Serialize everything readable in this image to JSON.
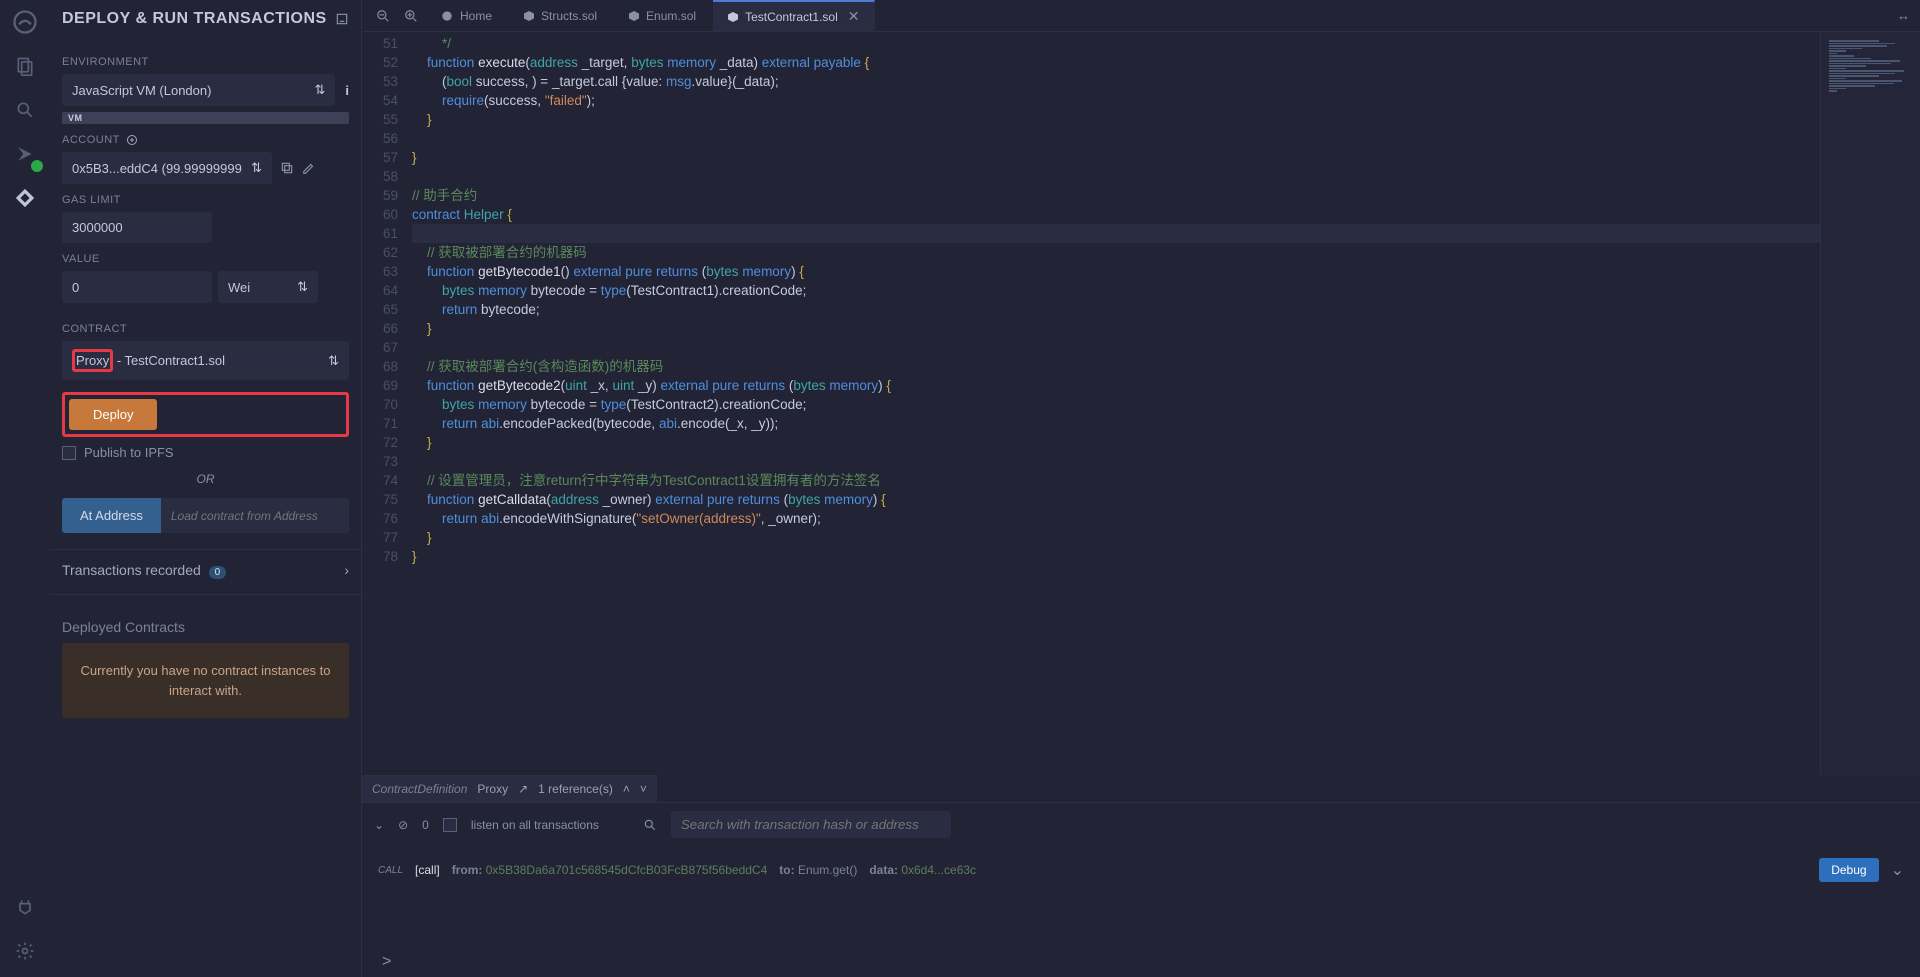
{
  "panel": {
    "title": "DEPLOY & RUN TRANSACTIONS",
    "env_label": "ENVIRONMENT",
    "env_value": "JavaScript VM (London)",
    "env_chip": "VM",
    "account_label": "ACCOUNT",
    "account_value": "0x5B3...eddC4 (99.99999999",
    "gas_label": "GAS LIMIT",
    "gas_value": "3000000",
    "value_label": "VALUE",
    "value_amount": "0",
    "value_unit": "Wei",
    "contract_label": "CONTRACT",
    "contract_prefix": "Proxy",
    "contract_suffix": " - TestContract1.sol",
    "deploy_btn": "Deploy",
    "publish_ipfs": "Publish to IPFS",
    "or_text": "OR",
    "at_address_btn": "At Address",
    "at_address_ph": "Load contract from Address",
    "tx_recorded": "Transactions recorded",
    "tx_badge": "0",
    "deployed_label": "Deployed Contracts",
    "no_instances": "Currently you have no contract instances to interact with."
  },
  "tabs": {
    "home": "Home",
    "t1": "Structs.sol",
    "t2": "Enum.sol",
    "t3": "TestContract1.sol"
  },
  "code_lines": [
    {
      "n": 51,
      "html": "        <span class='c-com'>*/</span>"
    },
    {
      "n": 52,
      "html": "    <span class='c-kw'>function</span> <span class='c-fn'>execute</span>(<span class='c-type'>address</span> _target, <span class='c-type'>bytes</span> <span class='c-kw'>memory</span> _data) <span class='c-kw'>external</span> <span class='c-kw'>payable</span> <span class='c-paren'>{</span>"
    },
    {
      "n": 53,
      "html": "        (<span class='c-type'>bool</span> success, ) = _target.call {value: <span class='c-kw'>msg</span>.value}(_data);"
    },
    {
      "n": 54,
      "html": "        <span class='c-kw'>require</span>(success, <span class='c-str'>\"failed\"</span>);"
    },
    {
      "n": 55,
      "html": "    <span class='c-paren'>}</span>"
    },
    {
      "n": 56,
      "html": ""
    },
    {
      "n": 57,
      "html": "<span class='c-paren'>}</span>"
    },
    {
      "n": 58,
      "html": ""
    },
    {
      "n": 59,
      "html": "<span class='c-com'>// 助手合约</span>"
    },
    {
      "n": 60,
      "html": "<span class='c-kw'>contract</span> <span class='c-type'>Helper</span> <span class='c-paren'>{</span>"
    },
    {
      "n": 61,
      "html": "",
      "cur": true
    },
    {
      "n": 62,
      "html": "    <span class='c-com'>// 获取被部署合约的机器码</span>"
    },
    {
      "n": 63,
      "html": "    <span class='c-kw'>function</span> <span class='c-fn'>getBytecode1</span>() <span class='c-kw'>external</span> <span class='c-kw'>pure</span> <span class='c-kw'>returns</span> (<span class='c-type'>bytes</span> <span class='c-kw'>memory</span>) <span class='c-paren'>{</span>"
    },
    {
      "n": 64,
      "html": "        <span class='c-type'>bytes</span> <span class='c-kw'>memory</span> bytecode = <span class='c-kw'>type</span>(TestContract1).creationCode;"
    },
    {
      "n": 65,
      "html": "        <span class='c-kw'>return</span> bytecode;"
    },
    {
      "n": 66,
      "html": "    <span class='c-paren'>}</span>"
    },
    {
      "n": 67,
      "html": ""
    },
    {
      "n": 68,
      "html": "    <span class='c-com'>// 获取被部署合约(含构造函数)的机器码</span>"
    },
    {
      "n": 69,
      "html": "    <span class='c-kw'>function</span> <span class='c-fn'>getBytecode2</span>(<span class='c-type'>uint</span> _x, <span class='c-type'>uint</span> _y) <span class='c-kw'>external</span> <span class='c-kw'>pure</span> <span class='c-kw'>returns</span> (<span class='c-type'>bytes</span> <span class='c-kw'>memory</span>) <span class='c-paren'>{</span>"
    },
    {
      "n": 70,
      "html": "        <span class='c-type'>bytes</span> <span class='c-kw'>memory</span> bytecode = <span class='c-kw'>type</span>(TestContract2).creationCode;"
    },
    {
      "n": 71,
      "html": "        <span class='c-kw'>return</span> <span class='c-kw'>abi</span>.encodePacked(bytecode, <span class='c-kw'>abi</span>.encode(_x, _y));"
    },
    {
      "n": 72,
      "html": "    <span class='c-paren'>}</span>"
    },
    {
      "n": 73,
      "html": ""
    },
    {
      "n": 74,
      "html": "    <span class='c-com'>// 设置管理员，注意return行中字符串为TestContract1设置拥有者的方法签名</span>"
    },
    {
      "n": 75,
      "html": "    <span class='c-kw'>function</span> <span class='c-fn'>getCalldata</span>(<span class='c-type'>address</span> _owner) <span class='c-kw'>external</span> <span class='c-kw'>pure</span> <span class='c-kw'>returns</span> (<span class='c-type'>bytes</span> <span class='c-kw'>memory</span>) <span class='c-paren'>{</span>"
    },
    {
      "n": 76,
      "html": "        <span class='c-kw'>return</span> <span class='c-kw'>abi</span>.encodeWithSignature(<span class='c-str'>\"setOwner(address)\"</span>, _owner);"
    },
    {
      "n": 77,
      "html": "    <span class='c-paren'>}</span>"
    },
    {
      "n": 78,
      "html": "<span class='c-paren'>}</span>"
    }
  ],
  "breadcrumb": {
    "kind": "ContractDefinition",
    "name": "Proxy",
    "refs": "1 reference(s)"
  },
  "terminal": {
    "listen": "listen on all transactions",
    "search_ph": "Search with transaction hash or address",
    "count": "0",
    "call_lbl": "[call]",
    "from_lbl": "from:",
    "from_val": "0x5B38Da6a701c568545dCfcB03FcB875f56beddC4",
    "to_lbl": "to:",
    "to_val": "Enum.get()",
    "data_lbl": "data:",
    "data_val": "0x6d4...ce63c",
    "debug": "Debug",
    "prompt": ">"
  }
}
